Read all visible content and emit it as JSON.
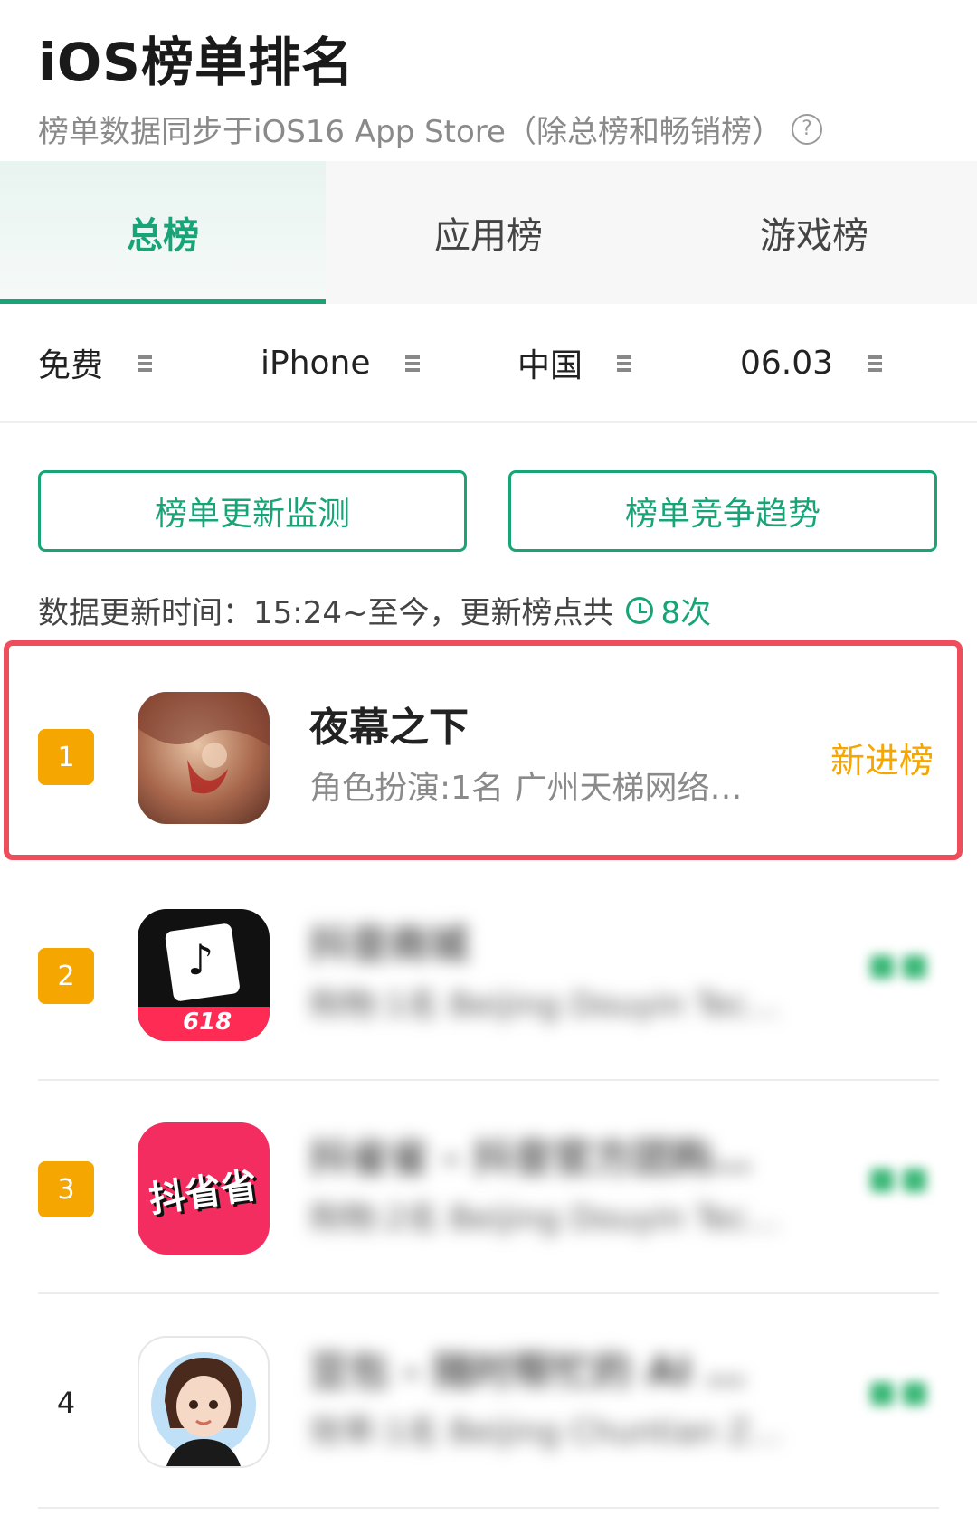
{
  "header": {
    "title": "iOS榜单排名",
    "subtitle": "榜单数据同步于iOS16 App Store（除总榜和畅销榜）",
    "help_symbol": "?"
  },
  "tabs": [
    {
      "label": "总榜",
      "active": true
    },
    {
      "label": "应用榜",
      "active": false
    },
    {
      "label": "游戏榜",
      "active": false
    }
  ],
  "filters": {
    "price": "免费",
    "device": "iPhone",
    "region": "中国",
    "date": "06.03"
  },
  "actions": {
    "monitor_label": "榜单更新监测",
    "trend_label": "榜单竞争趋势"
  },
  "update_info": {
    "text": "数据更新时间：15:24~至今，更新榜点共",
    "count": "8次"
  },
  "apps": [
    {
      "rank": "1",
      "name": "夜幕之下",
      "meta": "角色扮演:1名  广州天梯网络…",
      "status": "新进榜",
      "highlighted": true
    },
    {
      "rank": "2",
      "name": "抖音商城",
      "meta": "购物:1名  Beijing Douyin Tec…",
      "icon_text": "618"
    },
    {
      "rank": "3",
      "name": "抖省省 - 抖音官方团购…",
      "meta": "购物:2名  Beijing Douyin Tec…",
      "icon_text": "抖省省"
    },
    {
      "rank": "4",
      "name": "豆包 - 随时帮忙的 AI …",
      "meta": "效率:1名  Beijing Chuntian Z…"
    }
  ],
  "colors": {
    "accent": "#19a477",
    "rank_badge": "#f5a600",
    "highlight": "#ee4e5b"
  }
}
